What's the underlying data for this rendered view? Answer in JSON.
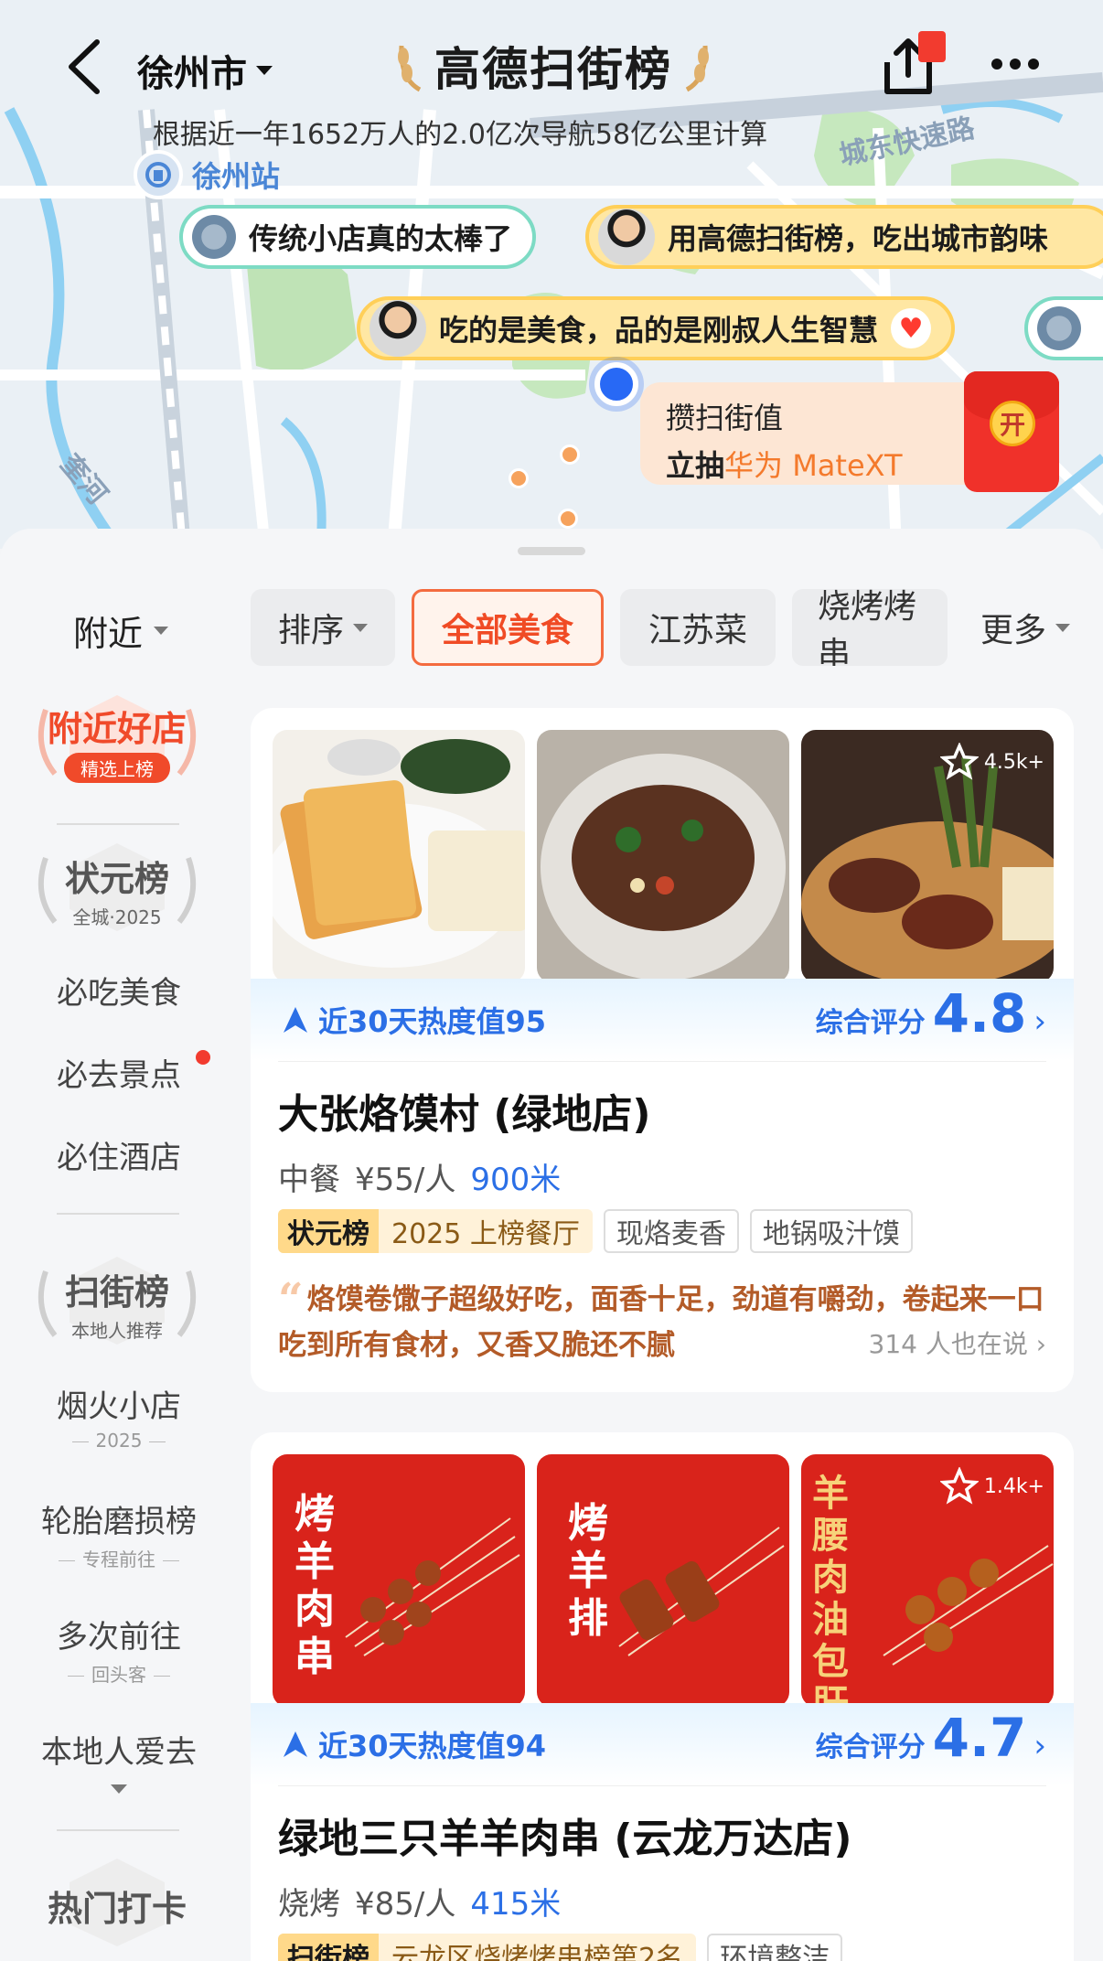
{
  "header": {
    "city": "徐州市",
    "brand": "高德扫街榜",
    "subtitle": "根据近一年1652万人的2.0亿次导航58亿公里计算"
  },
  "map": {
    "station": "徐州站",
    "road_label": "城东快速路",
    "river_label": "奎河",
    "bubbles": [
      "传统小店真的太棒了",
      "用高德扫街榜，吃出城市韵味",
      "吃的是美食，品的是刚叔人生智慧"
    ],
    "promo": {
      "line1": "攒扫街值",
      "line2_prefix": "立抽",
      "line2_highlight": "华为 MateXT",
      "button": "开"
    }
  },
  "filters": {
    "nearby": "附近",
    "sort": "排序",
    "all_food": "全部美食",
    "jiangsu": "江苏菜",
    "bbq": "烧烤烤串",
    "more": "更多"
  },
  "sidebar": {
    "nearby_good": {
      "title": "附近好店",
      "sub": "精选上榜"
    },
    "zhuangyuan": {
      "title": "状元榜",
      "sub": "全城·2025"
    },
    "must_eat": "必吃美食",
    "must_visit": "必去景点",
    "must_stay": "必住酒店",
    "saojie": {
      "title": "扫街榜",
      "sub": "本地人推荐"
    },
    "yanhuo": {
      "title": "烟火小店",
      "sub": "2025"
    },
    "tire": {
      "title": "轮胎磨损榜",
      "sub": "专程前往"
    },
    "multi": {
      "title": "多次前往",
      "sub": "回头客"
    },
    "local": "本地人爱去",
    "hot": "热门打卡"
  },
  "cards": [
    {
      "fav_count": "4.5k+",
      "heat_label": "近30天热度值95",
      "score_label": "综合评分",
      "score": "4.8",
      "name": "大张烙馍村 (绿地店)",
      "category": "中餐",
      "price": "¥55/人",
      "distance": "900米",
      "rank_badge": "状元榜",
      "rank_text": "2025 上榜餐厅",
      "tags": [
        "现烙麦香",
        "地锅吸汁馍"
      ],
      "quote": "烙馍卷馓子超级好吃，面香十足，劲道有嚼劲，卷起来一口吃到所有食材，又香又脆还不腻",
      "say": "314 人也在说"
    },
    {
      "fav_count": "1.4k+",
      "heat_label": "近30天热度值94",
      "score_label": "综合评分",
      "score": "4.7",
      "name": "绿地三只羊羊肉串 (云龙万达店)",
      "category": "烧烤",
      "price": "¥85/人",
      "distance": "415米",
      "rank_badge": "扫街榜",
      "rank_text": "云龙区烧烤烤串榜第2名",
      "tags": [
        "环境整洁"
      ],
      "photo_texts": [
        "烤羊肉串",
        "烤羊排",
        "羊腰肉油包肝"
      ]
    }
  ],
  "colors": {
    "accent_blue": "#2b6fe6",
    "accent_orange": "#f04b25",
    "quote_brown": "#b35b28"
  }
}
